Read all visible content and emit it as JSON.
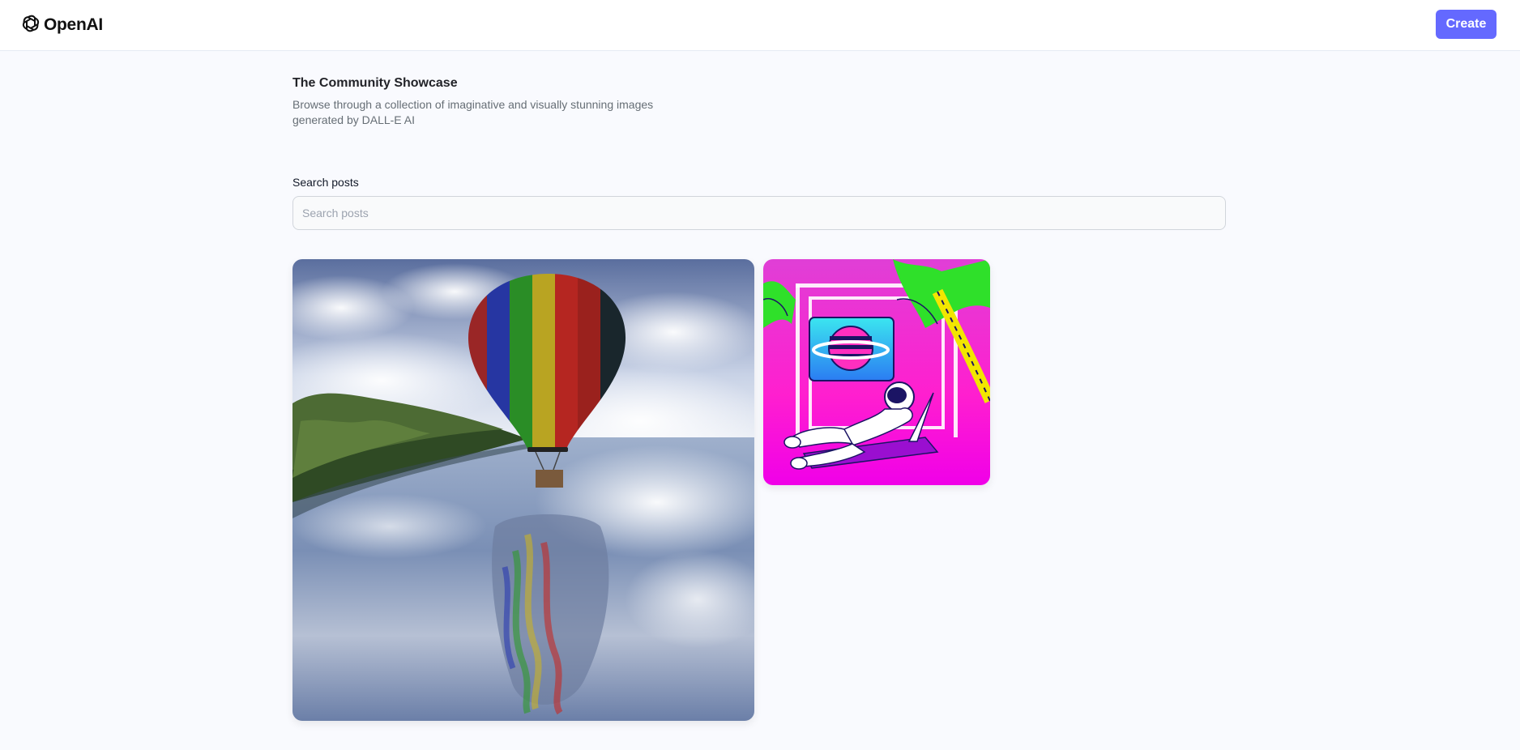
{
  "header": {
    "logo_text": "OpenAI",
    "create_label": "Create",
    "accent_color": "#6469ff"
  },
  "hero": {
    "title": "The Community Showcase",
    "subtitle": "Browse through a collection of imaginative and visually stunning images generated by DALL-E AI"
  },
  "search": {
    "label": "Search posts",
    "placeholder": "Search posts",
    "value": ""
  },
  "posts": [
    {
      "subject": "hot-air-balloon-over-lake"
    },
    {
      "subject": "astronaut-lounging-vaporwave"
    }
  ]
}
